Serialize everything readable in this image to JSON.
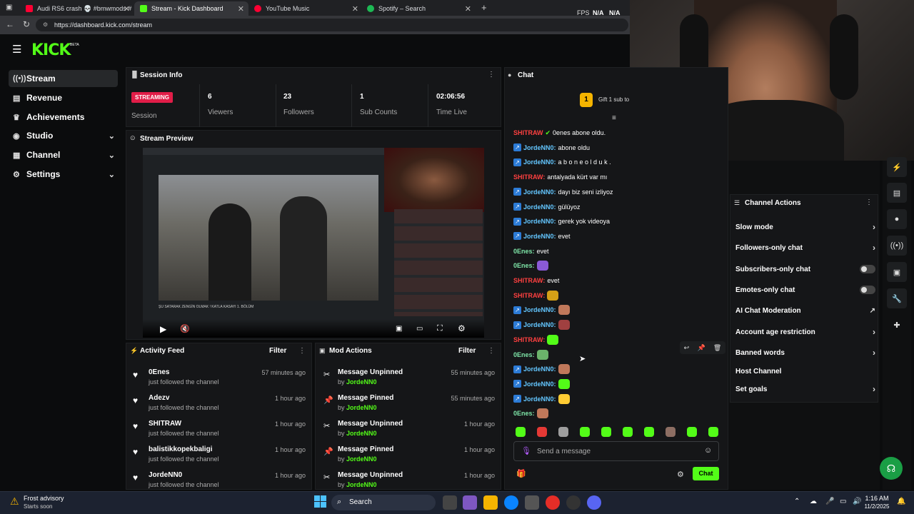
{
  "browser": {
    "tabs": [
      {
        "title": "Audi RS6 crash 💀 #bmwmods #",
        "color": "#ff0033"
      },
      {
        "title": "Stream - Kick Dashboard",
        "color": "#53fc18"
      },
      {
        "title": "YouTube Music",
        "color": "#ff0033"
      },
      {
        "title": "Spotify – Search",
        "color": "#1db954"
      }
    ],
    "url": "https://dashboard.kick.com/stream",
    "fps_label": "FPS",
    "fps_val1": "N/A",
    "fps_val2": "N/A"
  },
  "kick": {
    "logo": "KICK",
    "beta": "BETA"
  },
  "sidebar": {
    "items": [
      {
        "label": "Stream",
        "icon": "stream-icon"
      },
      {
        "label": "Revenue",
        "icon": "revenue-icon"
      },
      {
        "label": "Achievements",
        "icon": "trophy-icon"
      },
      {
        "label": "Studio",
        "icon": "studio-icon"
      },
      {
        "label": "Channel",
        "icon": "channel-icon"
      },
      {
        "label": "Settings",
        "icon": "gear-icon"
      }
    ]
  },
  "session": {
    "title": "Session Info",
    "status": "STREAMING",
    "status_label": "Session",
    "stats": [
      {
        "value": "6",
        "label": "Viewers"
      },
      {
        "value": "23",
        "label": "Followers"
      },
      {
        "value": "1",
        "label": "Sub Counts"
      },
      {
        "value": "02:06:56",
        "label": "Time Live"
      }
    ]
  },
  "preview": {
    "title": "Stream Preview",
    "video_caption": "ŞU SATARAK ZENGİN OLMAK ! KATLA KASAYI 1. BÖLÜM"
  },
  "activity": {
    "title": "Activity Feed",
    "filter": "Filter",
    "items": [
      {
        "name": "0Enes",
        "sub": "just followed the channel",
        "time": "57 minutes ago"
      },
      {
        "name": "Adezv",
        "sub": "just followed the channel",
        "time": "1 hour ago"
      },
      {
        "name": "SHITRAW",
        "sub": "just followed the channel",
        "time": "1 hour ago"
      },
      {
        "name": "balistikkopekbaligi",
        "sub": "just followed the channel",
        "time": "1 hour ago"
      },
      {
        "name": "JordeNN0",
        "sub": "just followed the channel",
        "time": "1 hour ago"
      }
    ]
  },
  "mod": {
    "title": "Mod Actions",
    "filter": "Filter",
    "by_prefix": "by",
    "items": [
      {
        "action": "Message Unpinned",
        "by": "JordeNN0",
        "time": "55 minutes ago"
      },
      {
        "action": "Message Pinned",
        "by": "JordeNN0",
        "time": "55 minutes ago"
      },
      {
        "action": "Message Unpinned",
        "by": "JordeNN0",
        "time": "1 hour ago"
      },
      {
        "action": "Message Pinned",
        "by": "JordeNN0",
        "time": "1 hour ago"
      },
      {
        "action": "Message Unpinned",
        "by": "JordeNN0",
        "time": "1 hour ago"
      }
    ]
  },
  "chat": {
    "title": "Chat",
    "gift_count": "1",
    "gift_text": "Gift 1 sub to",
    "messages": [
      {
        "user": "SHITRAW",
        "cls": "shit",
        "text": "0enes abone oldu.",
        "badge": false
      },
      {
        "user": "JordeNN0:",
        "cls": "jord",
        "text": "abone oldu",
        "badge": true
      },
      {
        "user": "JordeNN0:",
        "cls": "jord",
        "text": "a b o n e  o l d u k .",
        "badge": true
      },
      {
        "user": "SHITRAW:",
        "cls": "shit",
        "text": "antalyada kürt var mı",
        "badge": false
      },
      {
        "user": "JordeNN0:",
        "cls": "jord",
        "text": "dayı biz seni izliyoz",
        "badge": true
      },
      {
        "user": "JordeNN0:",
        "cls": "jord",
        "text": "gülüyoz",
        "badge": true
      },
      {
        "user": "JordeNN0:",
        "cls": "jord",
        "text": "gerek yok videoya",
        "badge": true
      },
      {
        "user": "JordeNN0:",
        "cls": "jord",
        "text": "evet",
        "badge": true
      },
      {
        "user": "0Enes:",
        "cls": "enes",
        "text": "evet",
        "badge": false
      },
      {
        "user": "0Enes:",
        "cls": "enes",
        "text": "",
        "badge": false
      },
      {
        "user": "SHITRAW:",
        "cls": "shit",
        "text": "evet",
        "badge": false
      },
      {
        "user": "SHITRAW:",
        "cls": "shit",
        "text": "",
        "badge": false
      },
      {
        "user": "JordeNN0:",
        "cls": "jord",
        "text": "",
        "badge": true
      },
      {
        "user": "JordeNN0:",
        "cls": "jord",
        "text": "",
        "badge": true
      },
      {
        "user": "SHITRAW:",
        "cls": "shit",
        "text": "",
        "badge": false
      },
      {
        "user": "0Enes:",
        "cls": "enes",
        "text": "",
        "badge": false
      },
      {
        "user": "JordeNN0:",
        "cls": "jord",
        "text": "",
        "badge": true
      },
      {
        "user": "JordeNN0:",
        "cls": "jord",
        "text": "",
        "badge": true
      },
      {
        "user": "JordeNN0:",
        "cls": "jord",
        "text": "",
        "badge": true
      },
      {
        "user": "0Enes:",
        "cls": "enes",
        "text": "",
        "badge": false
      }
    ],
    "placeholder": "Send a message",
    "send": "Chat"
  },
  "channel_actions": {
    "title": "Channel Actions",
    "items": [
      {
        "label": "Slow mode",
        "type": "chevron"
      },
      {
        "label": "Followers-only chat",
        "type": "chevron"
      },
      {
        "label": "Subscribers-only chat",
        "type": "toggle"
      },
      {
        "label": "Emotes-only chat",
        "type": "toggle"
      },
      {
        "label": "AI Chat Moderation",
        "type": "external"
      },
      {
        "label": "Account age restriction",
        "type": "chevron"
      },
      {
        "label": "Banned words",
        "type": "chevron"
      },
      {
        "label": "Host Channel",
        "type": "none"
      },
      {
        "label": "Set goals",
        "type": "chevron"
      }
    ]
  },
  "taskbar": {
    "weather_title": "Frost advisory",
    "weather_sub": "Starts soon",
    "search": "Search",
    "time": "1:16 AM",
    "date": "11/2/2025"
  }
}
